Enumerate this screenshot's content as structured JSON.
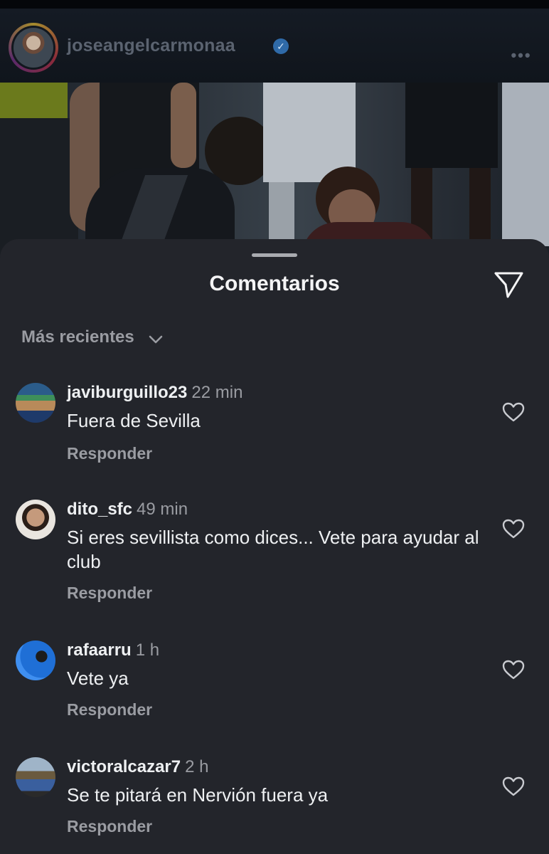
{
  "post": {
    "username": "joseangelcarmonaa",
    "verified_icon": "verified-badge-icon",
    "more_icon": "more-options-icon"
  },
  "sheet": {
    "title": "Comentarios",
    "share_icon": "paper-plane-icon",
    "sort_label": "Más recientes",
    "sort_icon": "chevron-down-icon"
  },
  "comments": [
    {
      "user": "javiburguillo23",
      "time": "22 min",
      "text": "Fuera de Sevilla",
      "reply": "Responder"
    },
    {
      "user": "dito_sfc",
      "time": "49 min",
      "text": "Si eres sevillista como dices... Vete para ayudar al club",
      "reply": "Responder"
    },
    {
      "user": "rafaarru",
      "time": "1 h",
      "text": "Vete ya",
      "reply": "Responder"
    },
    {
      "user": "victoralcazar7",
      "time": "2 h",
      "text": "Se te pitará en Nervión fuera ya",
      "reply": "Responder"
    }
  ],
  "colors": {
    "sheet_bg": "#23252b",
    "text_primary": "#eef0f2",
    "text_secondary": "#9a9ca2"
  }
}
